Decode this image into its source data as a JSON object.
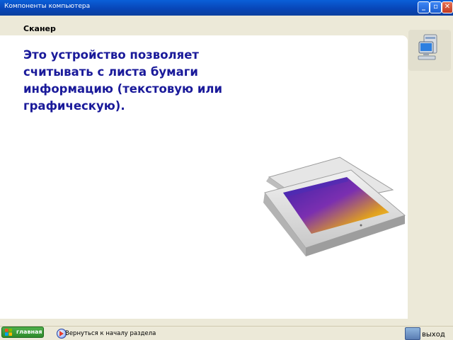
{
  "window": {
    "title": "Компоненты компьютера",
    "minimize_label": "_",
    "maximize_label": "▫",
    "close_label": "✕"
  },
  "page": {
    "heading": "Сканер",
    "description": "Это устройство позволяет считывать с листа бумаги информацию (текстовую или графическую)."
  },
  "icons": {
    "computer": "computer-icon",
    "scanner": "scanner-image",
    "home": "windows-logo-icon",
    "back": "back-arrow-icon",
    "exit": "exit-icon"
  },
  "nav": {
    "home_label": "главная",
    "back_label": "Вернуться к началу раздела",
    "exit_label": "выход"
  },
  "colors": {
    "titlebar": "#0a5fd8",
    "description_text": "#1a1a9a",
    "background": "#ece9d8",
    "content": "#ffffff",
    "home_button": "#3a9b37"
  }
}
